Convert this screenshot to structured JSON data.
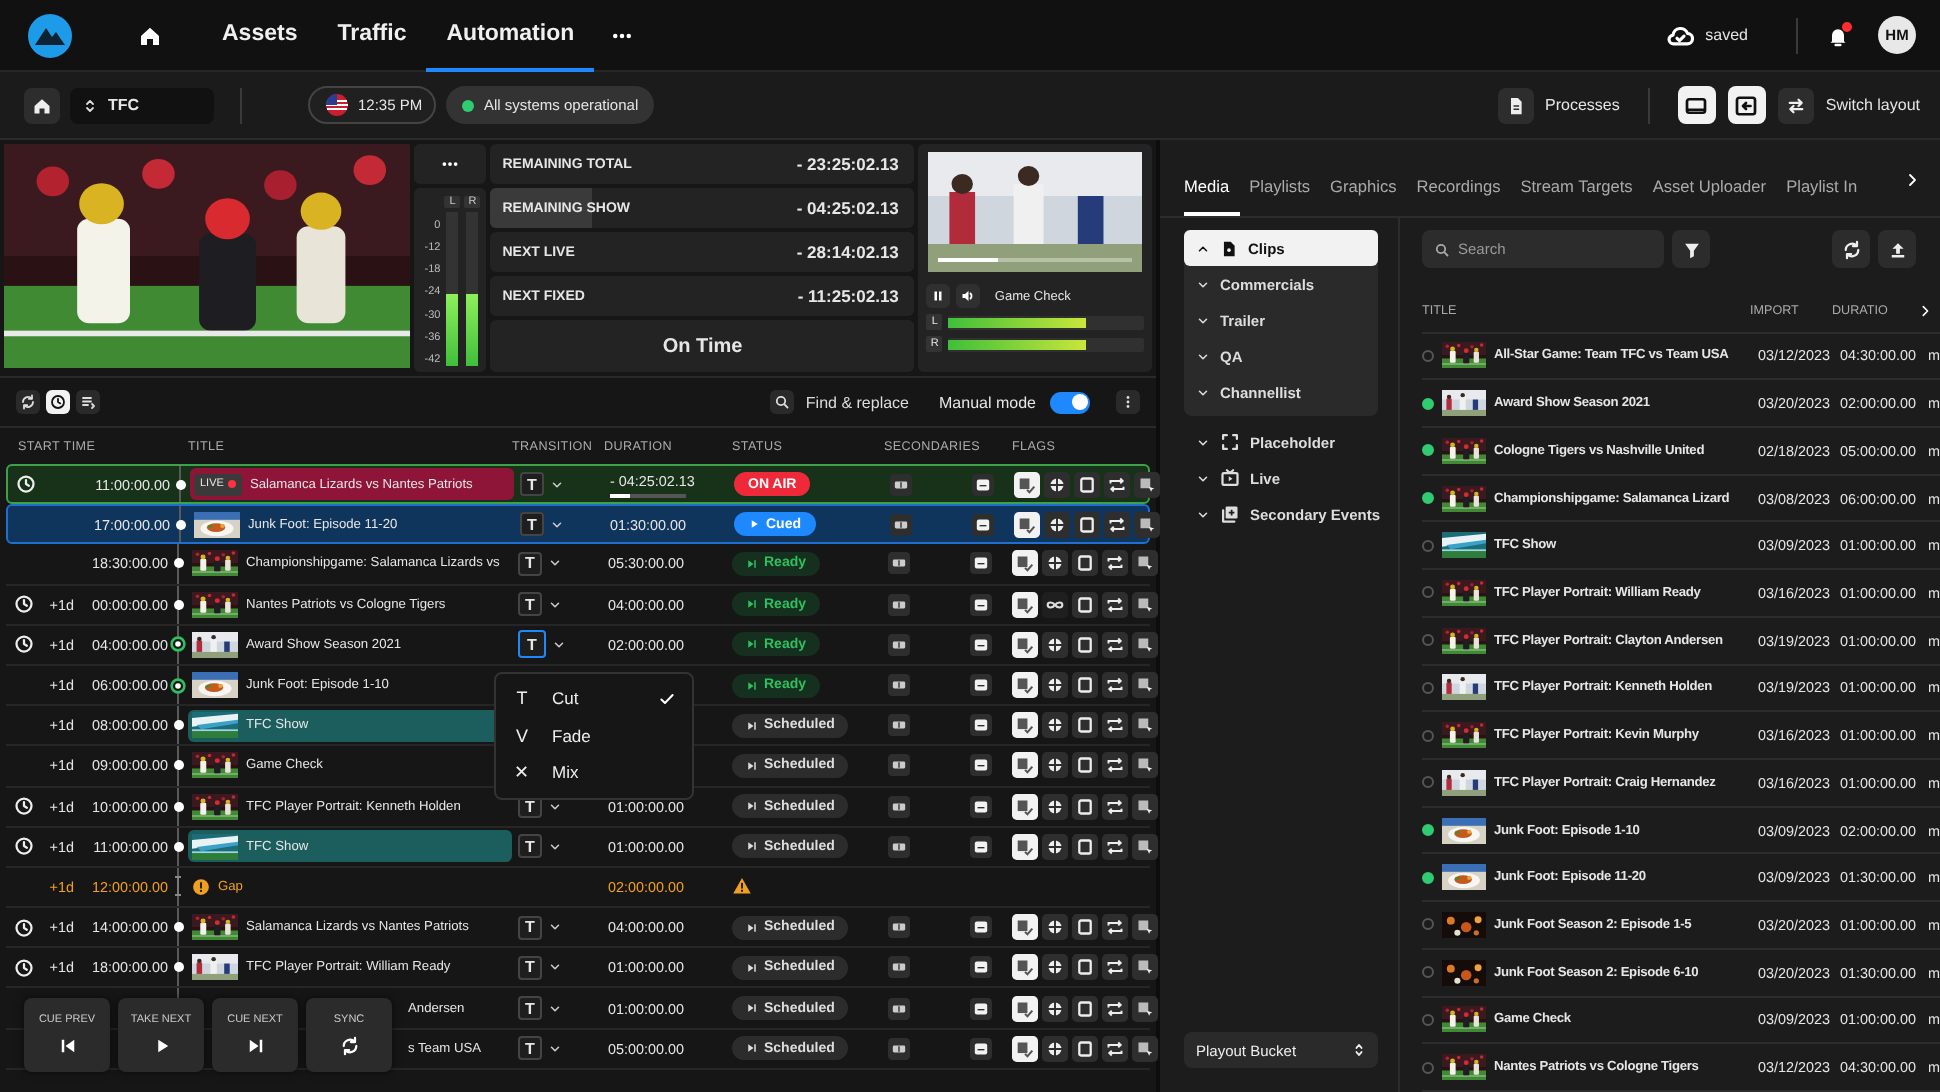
{
  "nav": {
    "items": [
      {
        "label": "Assets",
        "selected": false
      },
      {
        "label": "Traffic",
        "selected": false
      },
      {
        "label": "Automation",
        "selected": true
      }
    ],
    "saved": "saved",
    "unread": true,
    "avatar": "HM"
  },
  "toolbar": {
    "channel": "TFC",
    "time": "12:35 PM",
    "system_status": "All systems operational",
    "system_ok": true,
    "processes": "Processes",
    "switch_layout": "Switch layout"
  },
  "monitor": {
    "meter": {
      "scale": [
        "0",
        "-12",
        "-18",
        "-24",
        "-30",
        "-36",
        "-42"
      ],
      "channels": [
        {
          "label": "L",
          "level": 0.47
        },
        {
          "label": "R",
          "level": 0.47
        }
      ]
    },
    "timers": [
      {
        "label": "REMAINING TOTAL",
        "value": "- 23:25:02.13"
      },
      {
        "label": "REMAINING SHOW",
        "value": "- 04:25:02.13",
        "level": 0.24
      },
      {
        "label": "NEXT LIVE",
        "value": "- 28:14:02.13"
      },
      {
        "label": "NEXT FIXED",
        "value": "- 11:25:02.13"
      }
    ],
    "state": "On Time",
    "preview": {
      "title": "Game Check",
      "playing": true,
      "level": 0.3,
      "audio": [
        {
          "label": "L",
          "level": 0.7
        },
        {
          "label": "R",
          "level": 0.7
        }
      ]
    }
  },
  "tools": {
    "views": [
      {
        "kind": "refresh",
        "selected": false
      },
      {
        "kind": "clock",
        "selected": true
      },
      {
        "kind": "list",
        "selected": false
      }
    ],
    "find_replace": "Find & replace",
    "manual_mode": {
      "label": "Manual mode",
      "on": true
    }
  },
  "schedule": {
    "columns": [
      "START TIME",
      "TITLE",
      "TRANSITION",
      "DURATION",
      "STATUS",
      "SECONDARIES",
      "FLAGS"
    ],
    "rows": [
      {
        "kind": "live",
        "clock": true,
        "time": "11:00:00.00",
        "linked": false,
        "badge": "LIVE",
        "title": "Salamanca Lizards vs Nantes Patriots",
        "transition": "T",
        "focused": false,
        "duration": "- 04:25:02.13",
        "level": 0.25,
        "status": {
          "label": "ON AIR",
          "kind": "on_air"
        },
        "loop": false
      },
      {
        "kind": "clip",
        "clock": false,
        "time": "17:00:00.00",
        "linked": false,
        "title": "Junk Foot: Episode 11-20",
        "transition": "T",
        "focused": false,
        "duration": "01:30:00.00",
        "status": {
          "label": "Cued",
          "kind": "cued"
        },
        "loop": false
      },
      {
        "kind": "clip",
        "clock": false,
        "time": "18:30:00.00",
        "linked": false,
        "title": "Championshipgame: Salamanca Lizards vs",
        "transition": "T",
        "focused": false,
        "duration": "05:30:00.00",
        "status": {
          "label": "Ready",
          "kind": "ready"
        },
        "loop": false
      },
      {
        "kind": "clip",
        "clock": true,
        "day": "+1d",
        "time": "00:00:00.00",
        "linked": false,
        "title": "Nantes Patriots vs Cologne Tigers",
        "transition": "T",
        "focused": false,
        "duration": "04:00:00.00",
        "status": {
          "label": "Ready",
          "kind": "ready"
        },
        "loop": true
      },
      {
        "kind": "clip",
        "clock": true,
        "day": "+1d",
        "time": "04:00:00.00",
        "linked": true,
        "title": "Award Show Season 2021",
        "transition": "T",
        "focused": true,
        "duration": "02:00:00.00",
        "status": {
          "label": "Ready",
          "kind": "ready"
        },
        "loop": false
      },
      {
        "kind": "clip",
        "clock": false,
        "day": "+1d",
        "time": "06:00:00.00",
        "linked": true,
        "title": "Junk Foot: Episode 1-10",
        "status": {
          "label": "Ready",
          "kind": "ready"
        },
        "loop": false
      },
      {
        "kind": "show",
        "clock": false,
        "day": "+1d",
        "time": "08:00:00.00",
        "linked": false,
        "title": "TFC Show",
        "status": {
          "label": "Scheduled",
          "kind": "scheduled"
        },
        "loop": false
      },
      {
        "kind": "clip",
        "clock": false,
        "day": "+1d",
        "time": "09:00:00.00",
        "linked": false,
        "title": "Game Check",
        "status": {
          "label": "Scheduled",
          "kind": "scheduled"
        },
        "loop": false
      },
      {
        "kind": "clip",
        "clock": true,
        "day": "+1d",
        "time": "10:00:00.00",
        "linked": false,
        "title": "TFC Player Portrait: Kenneth Holden",
        "transition": "T",
        "focused": false,
        "duration": "01:00:00.00",
        "status": {
          "label": "Scheduled",
          "kind": "scheduled"
        },
        "loop": false
      },
      {
        "kind": "show",
        "clock": true,
        "day": "+1d",
        "time": "11:00:00.00",
        "linked": false,
        "title": "TFC Show",
        "transition": "T",
        "focused": false,
        "duration": "01:00:00.00",
        "status": {
          "label": "Scheduled",
          "kind": "scheduled"
        },
        "loop": false
      },
      {
        "kind": "gap",
        "clock": false,
        "day": "+1d",
        "time": "12:00:00.00",
        "title": "Gap",
        "duration": "02:00:00.00",
        "warning": true
      },
      {
        "kind": "clip",
        "clock": true,
        "day": "+1d",
        "time": "14:00:00.00",
        "linked": false,
        "title": "Salamanca Lizards vs Nantes Patriots",
        "transition": "T",
        "focused": false,
        "duration": "04:00:00.00",
        "status": {
          "label": "Scheduled",
          "kind": "scheduled"
        },
        "loop": false
      },
      {
        "kind": "clip",
        "clock": true,
        "day": "+1d",
        "time": "18:00:00.00",
        "linked": false,
        "title": "TFC Player Portrait: William Ready",
        "transition": "T",
        "focused": false,
        "duration": "01:00:00.00",
        "status": {
          "label": "Scheduled",
          "kind": "scheduled"
        },
        "loop": false
      },
      {
        "kind": "clip",
        "covered": true,
        "title": "Andersen",
        "transition": "T",
        "focused": false,
        "duration": "01:00:00.00",
        "status": {
          "label": "Scheduled",
          "kind": "scheduled"
        },
        "loop": false
      },
      {
        "kind": "clip",
        "covered": true,
        "title": "s Team USA",
        "transition": "T",
        "focused": false,
        "duration": "05:00:00.00",
        "status": {
          "label": "Scheduled",
          "kind": "scheduled"
        },
        "loop": false
      }
    ],
    "transition_menu": [
      {
        "glyph": "T",
        "label": "Cut",
        "selected": true
      },
      {
        "glyph": "V",
        "label": "Fade",
        "selected": false
      },
      {
        "glyph": "✕",
        "label": "Mix",
        "selected": false
      }
    ],
    "transport": [
      {
        "label": "CUE PREV",
        "kind": "prev"
      },
      {
        "label": "TAKE NEXT",
        "kind": "play"
      },
      {
        "label": "CUE NEXT",
        "kind": "next"
      },
      {
        "label": "SYNC",
        "kind": "sync"
      }
    ]
  },
  "media": {
    "tabs": [
      {
        "label": "Media",
        "selected": true
      },
      {
        "label": "Playlists",
        "selected": false
      },
      {
        "label": "Graphics",
        "selected": false
      },
      {
        "label": "Recordings",
        "selected": false
      },
      {
        "label": "Stream Targets",
        "selected": false
      },
      {
        "label": "Asset Uploader",
        "selected": false
      },
      {
        "label": "Playlist In",
        "selected": false
      }
    ],
    "folders": [
      {
        "label": "Clips",
        "expanded": true,
        "selected": true
      },
      {
        "label": "Commercials",
        "expanded": false,
        "selected": false
      },
      {
        "label": "Trailer",
        "expanded": false,
        "selected": false
      },
      {
        "label": "QA",
        "expanded": false,
        "selected": false
      },
      {
        "label": "Channellist",
        "expanded": false,
        "selected": false
      }
    ],
    "sections": [
      {
        "label": "Placeholder",
        "kind": "placeholder",
        "expanded": false
      },
      {
        "label": "Live",
        "kind": "live",
        "expanded": false
      },
      {
        "label": "Secondary Events",
        "kind": "secondary",
        "expanded": false
      }
    ],
    "bucket": "Playout Bucket",
    "search": {
      "placeholder": "Search"
    },
    "columns": [
      "TITLE",
      "IMPORT",
      "DURATIO"
    ],
    "rows": [
      {
        "available": false,
        "title": "All-Star Game: Team TFC vs Team USA",
        "import": "03/12/2023",
        "duration": "04:30:00.00",
        "column_4": "m"
      },
      {
        "available": true,
        "title": "Award Show Season 2021",
        "import": "03/20/2023",
        "duration": "02:00:00.00",
        "column_4": "m"
      },
      {
        "available": true,
        "title": "Cologne Tigers vs Nashville United",
        "import": "02/18/2023",
        "duration": "05:00:00.00",
        "column_4": "m"
      },
      {
        "available": true,
        "title": "Championshipgame: Salamanca Lizard",
        "import": "03/08/2023",
        "duration": "06:00:00.00",
        "column_4": "m"
      },
      {
        "available": false,
        "title": "TFC Show",
        "import": "03/09/2023",
        "duration": "01:00:00.00",
        "column_4": "m"
      },
      {
        "available": false,
        "title": "TFC Player Portrait: William Ready",
        "import": "03/16/2023",
        "duration": "01:00:00.00",
        "column_4": "m"
      },
      {
        "available": false,
        "title": "TFC Player Portrait: Clayton Andersen",
        "import": "03/19/2023",
        "duration": "01:00:00.00",
        "column_4": "m"
      },
      {
        "available": false,
        "title": "TFC Player Portrait: Kenneth Holden",
        "import": "03/19/2023",
        "duration": "01:00:00.00",
        "column_4": "m"
      },
      {
        "available": false,
        "title": "TFC Player Portrait: Kevin Murphy",
        "import": "03/16/2023",
        "duration": "01:00:00.00",
        "column_4": "m"
      },
      {
        "available": false,
        "title": "TFC Player Portrait: Craig Hernandez",
        "import": "03/16/2023",
        "duration": "01:00:00.00",
        "column_4": "m"
      },
      {
        "available": true,
        "title": "Junk Foot: Episode 1-10",
        "import": "03/09/2023",
        "duration": "02:00:00.00",
        "column_4": "m"
      },
      {
        "available": true,
        "title": "Junk Foot: Episode 11-20",
        "import": "03/09/2023",
        "duration": "01:30:00.00",
        "column_4": "m"
      },
      {
        "available": false,
        "title": "Junk Foot Season 2: Episode 1-5",
        "import": "03/20/2023",
        "duration": "01:00:00.00",
        "column_4": "m"
      },
      {
        "available": false,
        "title": "Junk Foot Season 2: Episode 6-10",
        "import": "03/20/2023",
        "duration": "01:30:00.00",
        "column_4": "m"
      },
      {
        "available": false,
        "title": "Game Check",
        "import": "03/09/2023",
        "duration": "01:00:00.00",
        "column_4": "m"
      },
      {
        "available": false,
        "title": "Nantes Patriots vs Cologne Tigers",
        "import": "03/12/2023",
        "duration": "04:30:00.00",
        "column_4": "m"
      }
    ]
  }
}
